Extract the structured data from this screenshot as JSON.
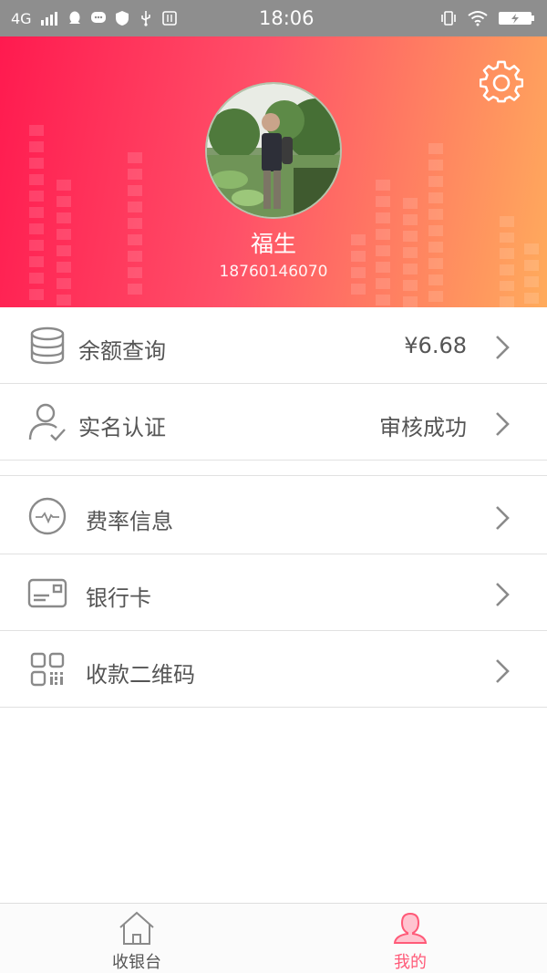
{
  "status_bar": {
    "network": "4G",
    "time": "18:06"
  },
  "profile": {
    "name": "福生",
    "phone": "18760146070"
  },
  "menu_group1": [
    {
      "label": "余额查询",
      "value": "¥6.68",
      "icon": "database-icon"
    },
    {
      "label": "实名认证",
      "value": "审核成功",
      "icon": "user-verified-icon"
    }
  ],
  "menu_group2": [
    {
      "label": "费率信息",
      "icon": "pulse-icon"
    },
    {
      "label": "银行卡",
      "icon": "bank-card-icon"
    },
    {
      "label": "收款二维码",
      "icon": "qr-code-icon"
    }
  ],
  "tabs": [
    {
      "label": "收银台",
      "icon": "home-icon",
      "active": false
    },
    {
      "label": "我的",
      "icon": "person-icon",
      "active": true
    }
  ],
  "colors": {
    "accent": "#ff5a78",
    "header_start": "#ff1a4f",
    "header_end": "#ffab5c",
    "text": "#555555",
    "inactive_tab": "#555555"
  }
}
